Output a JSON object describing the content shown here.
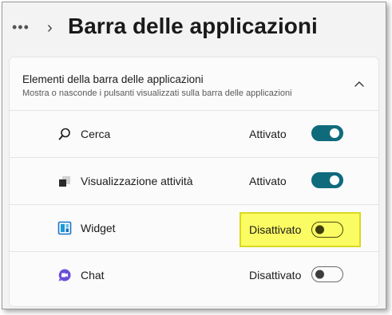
{
  "header": {
    "more_icon": "more-horizontal",
    "breadcrumb_chevron": "chevron-right",
    "title": "Barra delle applicazioni"
  },
  "section": {
    "title": "Elementi della barra delle applicazioni",
    "subtitle": "Mostra o nasconde i pulsanti visualizzati sulla barra delle applicazioni",
    "collapse_icon": "chevron-up"
  },
  "items": [
    {
      "icon": "search-icon",
      "label": "Cerca",
      "state_label": "Attivato",
      "on": true
    },
    {
      "icon": "task-view-icon",
      "label": "Visualizzazione attività",
      "state_label": "Attivato",
      "on": true
    },
    {
      "icon": "widgets-icon",
      "label": "Widget",
      "state_label": "Disattivato",
      "on": false,
      "highlighted": true
    },
    {
      "icon": "chat-icon",
      "label": "Chat",
      "state_label": "Disattivato",
      "on": false
    }
  ],
  "colors": {
    "toggle_on": "#0f6b7c",
    "highlight": "#fbfb63",
    "chat_icon": "#6a4fd8",
    "widgets_icon": "#1a73c8"
  }
}
